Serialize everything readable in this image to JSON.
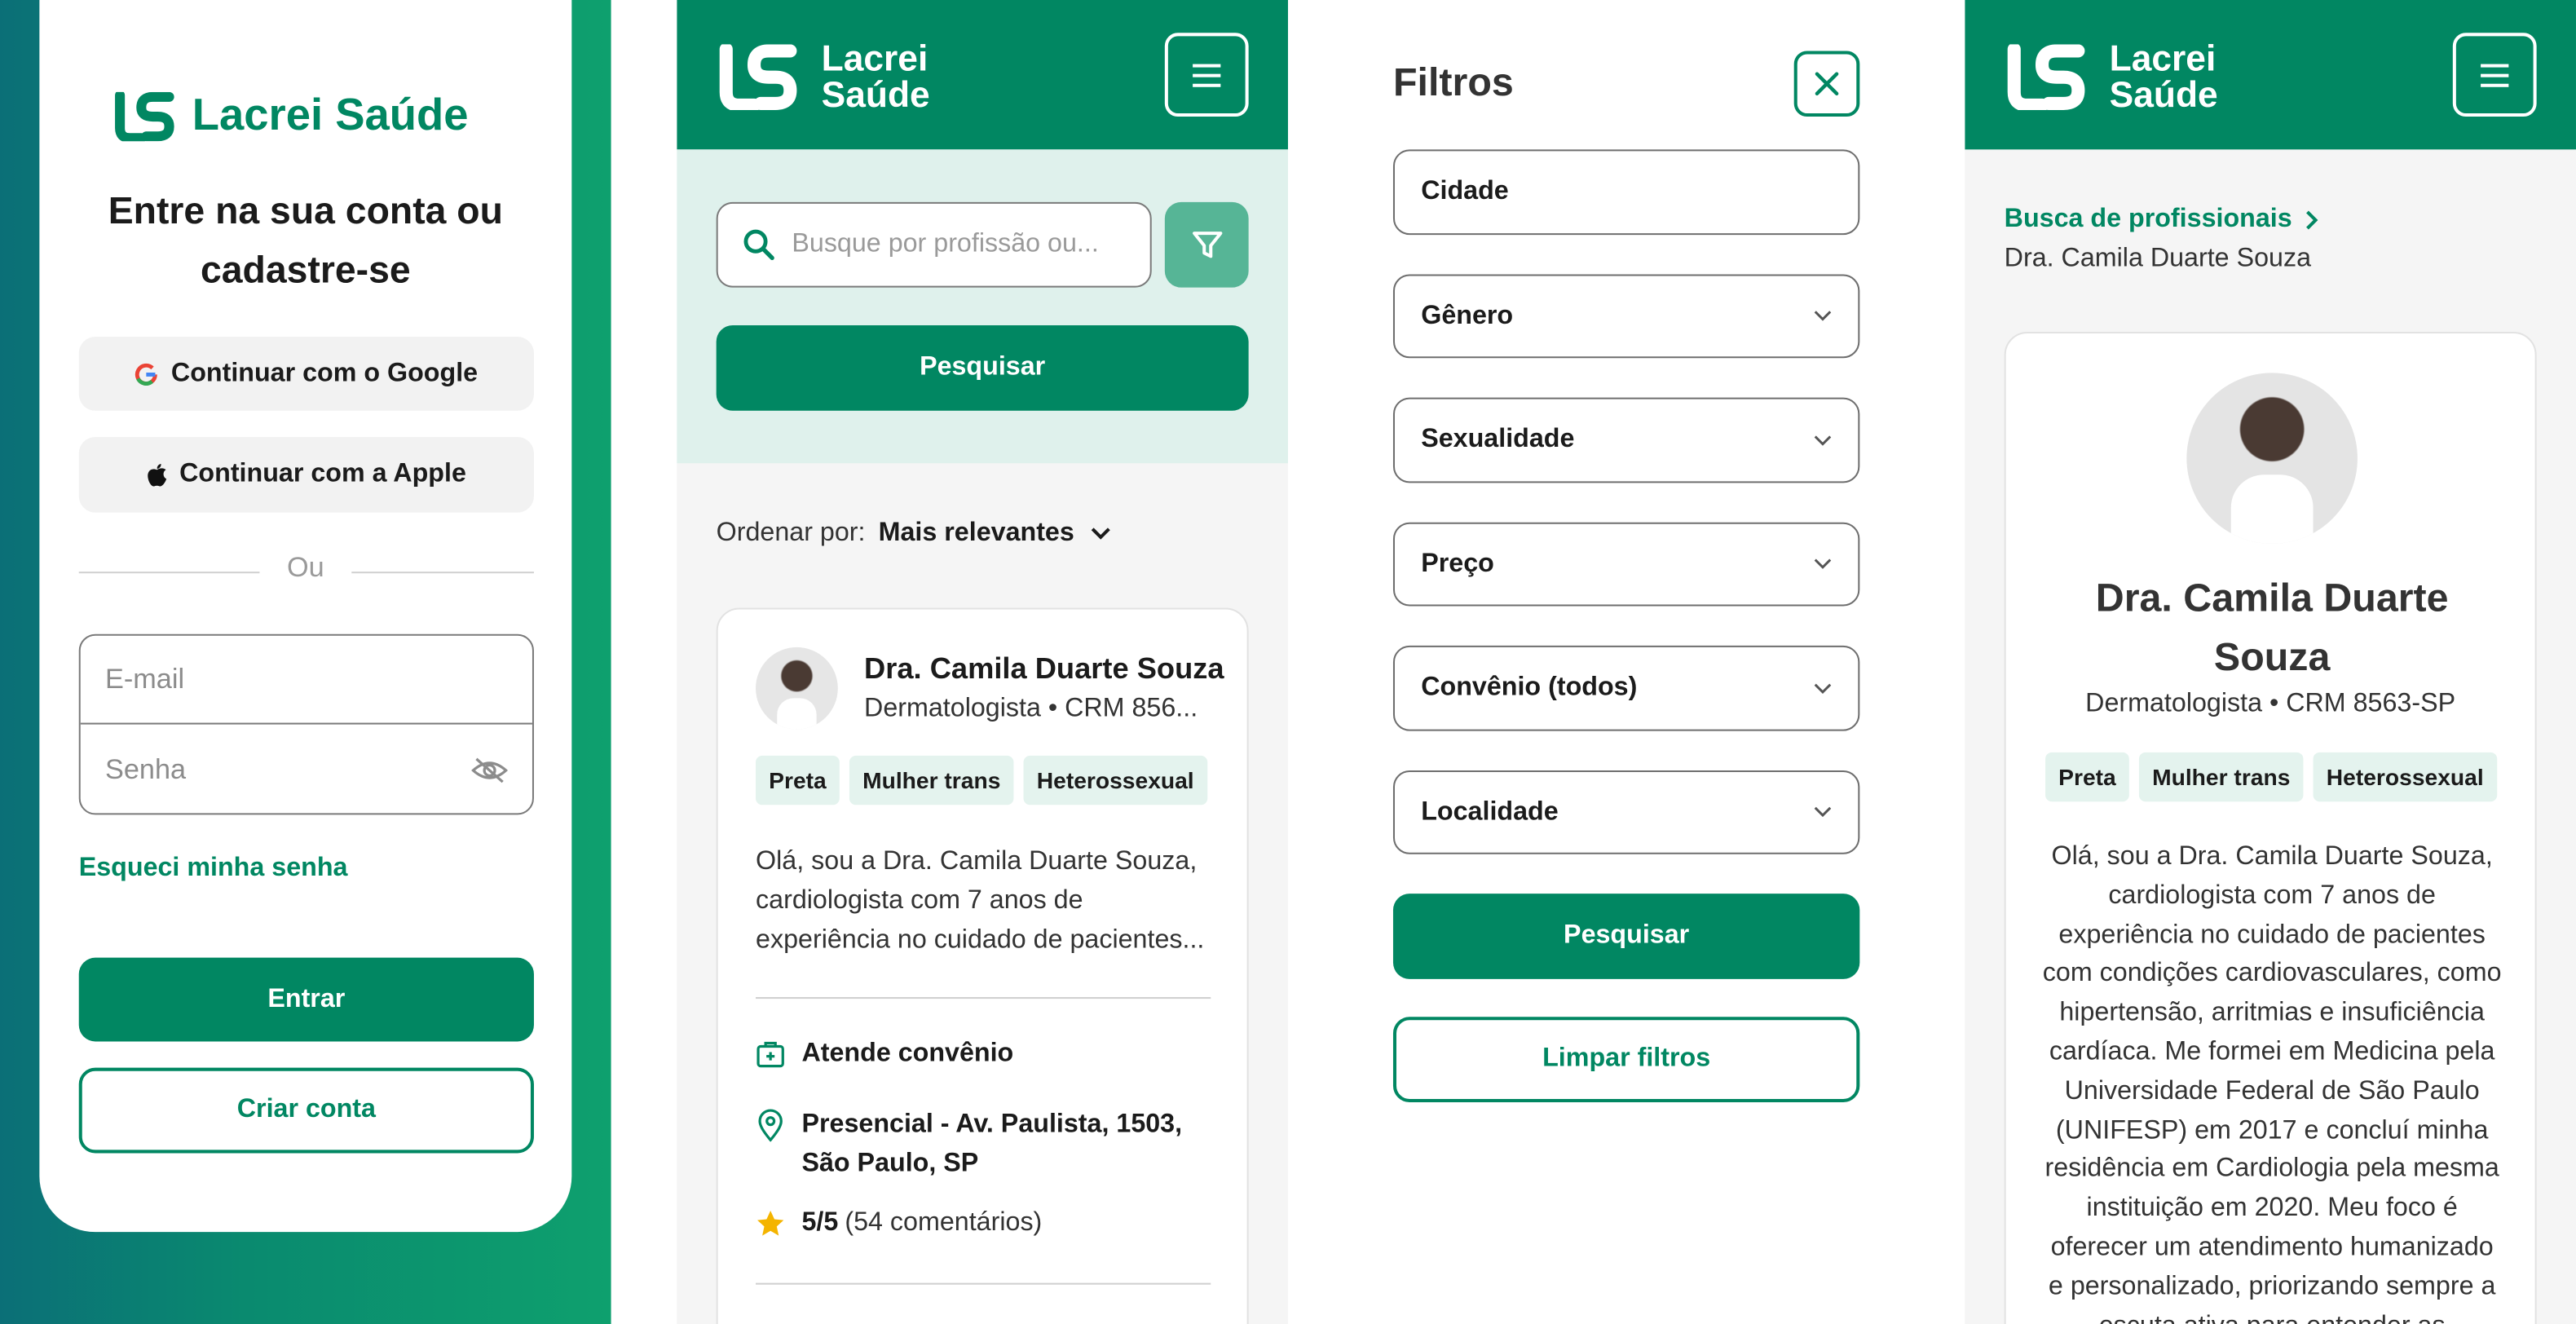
{
  "brand": {
    "name": "Lacrei Saúde",
    "line1": "Lacrei",
    "line2": "Saúde"
  },
  "colors": {
    "primary": "#018762",
    "tag_bg": "#E4F3EE",
    "star": "#F4B400"
  },
  "login": {
    "title": "Entre na sua conta ou cadastre-se",
    "google_label": "Continuar com o Google",
    "apple_label": "Continuar com a Apple",
    "divider": "Ou",
    "email_placeholder": "E-mail",
    "password_placeholder": "Senha",
    "forgot": "Esqueci minha senha",
    "enter": "Entrar",
    "create": "Criar conta"
  },
  "search": {
    "placeholder": "Busque por profissão ou...",
    "search_button": "Pesquisar",
    "order_label": "Ordenar por:",
    "order_value": "Mais relevantes",
    "card": {
      "name": "Dra. Camila Duarte Souza",
      "subtitle": "Dermatologista • CRM 856...",
      "tags": [
        "Preta",
        "Mulher trans",
        "Heterossexual"
      ],
      "bio": "Olá, sou a Dra. Camila Duarte Souza, cardiologista com 7 anos de experiência no cuidado de pacientes...",
      "insurance": "Atende convênio",
      "location": "Presencial - Av. Paulista, 1503, São Paulo, SP",
      "rating": "5/5",
      "reviews": "(54 comentários)"
    }
  },
  "filters": {
    "title": "Filtros",
    "fields": [
      "Cidade",
      "Gênero",
      "Sexualidade",
      "Preço",
      "Convênio (todos)",
      "Localidade"
    ],
    "search_button": "Pesquisar",
    "clear_button": "Limpar filtros"
  },
  "profile": {
    "breadcrumb_link": "Busca de profissionais",
    "breadcrumb_current": "Dra. Camila Duarte Souza",
    "name": "Dra. Camila Duarte Souza",
    "subtitle": "Dermatologista • CRM 8563-SP",
    "tags": [
      "Preta",
      "Mulher trans",
      "Heterossexual"
    ],
    "bio": "Olá, sou a Dra. Camila Duarte Souza, cardiologista com 7 anos de experiência no cuidado de pacientes com condições cardiovasculares, como hipertensão, arritmias e insuficiência cardíaca. Me formei em Medicina pela Universidade Federal de São Paulo (UNIFESP) em 2017 e concluí minha residência em Cardiologia pela mesma instituição em 2020. Meu foco é oferecer um atendimento humanizado e personalizado, priorizando sempre a escuta ativa para entender as"
  }
}
